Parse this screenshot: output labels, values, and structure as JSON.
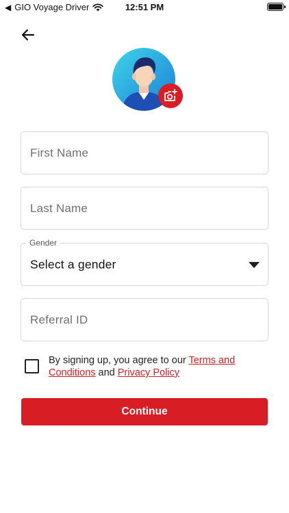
{
  "status_bar": {
    "back_glyph": "◀",
    "carrier": "GIO Voyage Driver",
    "time": "12:51 PM",
    "wifi_icon": "wifi-icon",
    "battery_icon": "battery-icon"
  },
  "header": {
    "back_icon": "arrow-left-icon"
  },
  "avatar": {
    "icon": "user-avatar-illustration",
    "camera_icon": "camera-add-icon",
    "accent_color": "#d91d24"
  },
  "form": {
    "first_name": {
      "placeholder": "First Name",
      "value": ""
    },
    "last_name": {
      "placeholder": "Last Name",
      "value": ""
    },
    "gender": {
      "label": "Gender",
      "selected": "Select a gender"
    },
    "referral": {
      "placeholder": "Referral ID",
      "value": ""
    }
  },
  "terms": {
    "checked": false,
    "prefix": "By signing up, you agree to our ",
    "terms_link": "Terms and Conditions",
    "middle": " and ",
    "privacy_link": "Privacy Policy"
  },
  "continue_label": "Continue"
}
